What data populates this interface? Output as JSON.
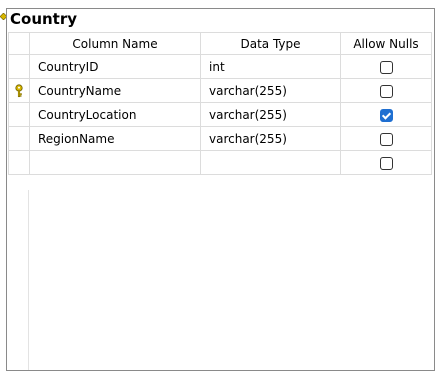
{
  "table": {
    "title": "Country",
    "columns": {
      "name": "Column Name",
      "type": "Data Type",
      "nulls": "Allow Nulls"
    },
    "rows": [
      {
        "name": "CountryID",
        "type": "int",
        "allow_nulls": false,
        "primary_key": false
      },
      {
        "name": "CountryName",
        "type": "varchar(255)",
        "allow_nulls": false,
        "primary_key": true
      },
      {
        "name": "CountryLocation",
        "type": "varchar(255)",
        "allow_nulls": true,
        "primary_key": false
      },
      {
        "name": "RegionName",
        "type": "varchar(255)",
        "allow_nulls": false,
        "primary_key": false
      },
      {
        "name": "",
        "type": "",
        "allow_nulls": false,
        "primary_key": false
      }
    ]
  },
  "icons": {
    "primary_key": "key-icon",
    "relationship": "connector-diamond-icon"
  },
  "colors": {
    "checked": "#1f6fd1",
    "key": "#d7b600"
  }
}
